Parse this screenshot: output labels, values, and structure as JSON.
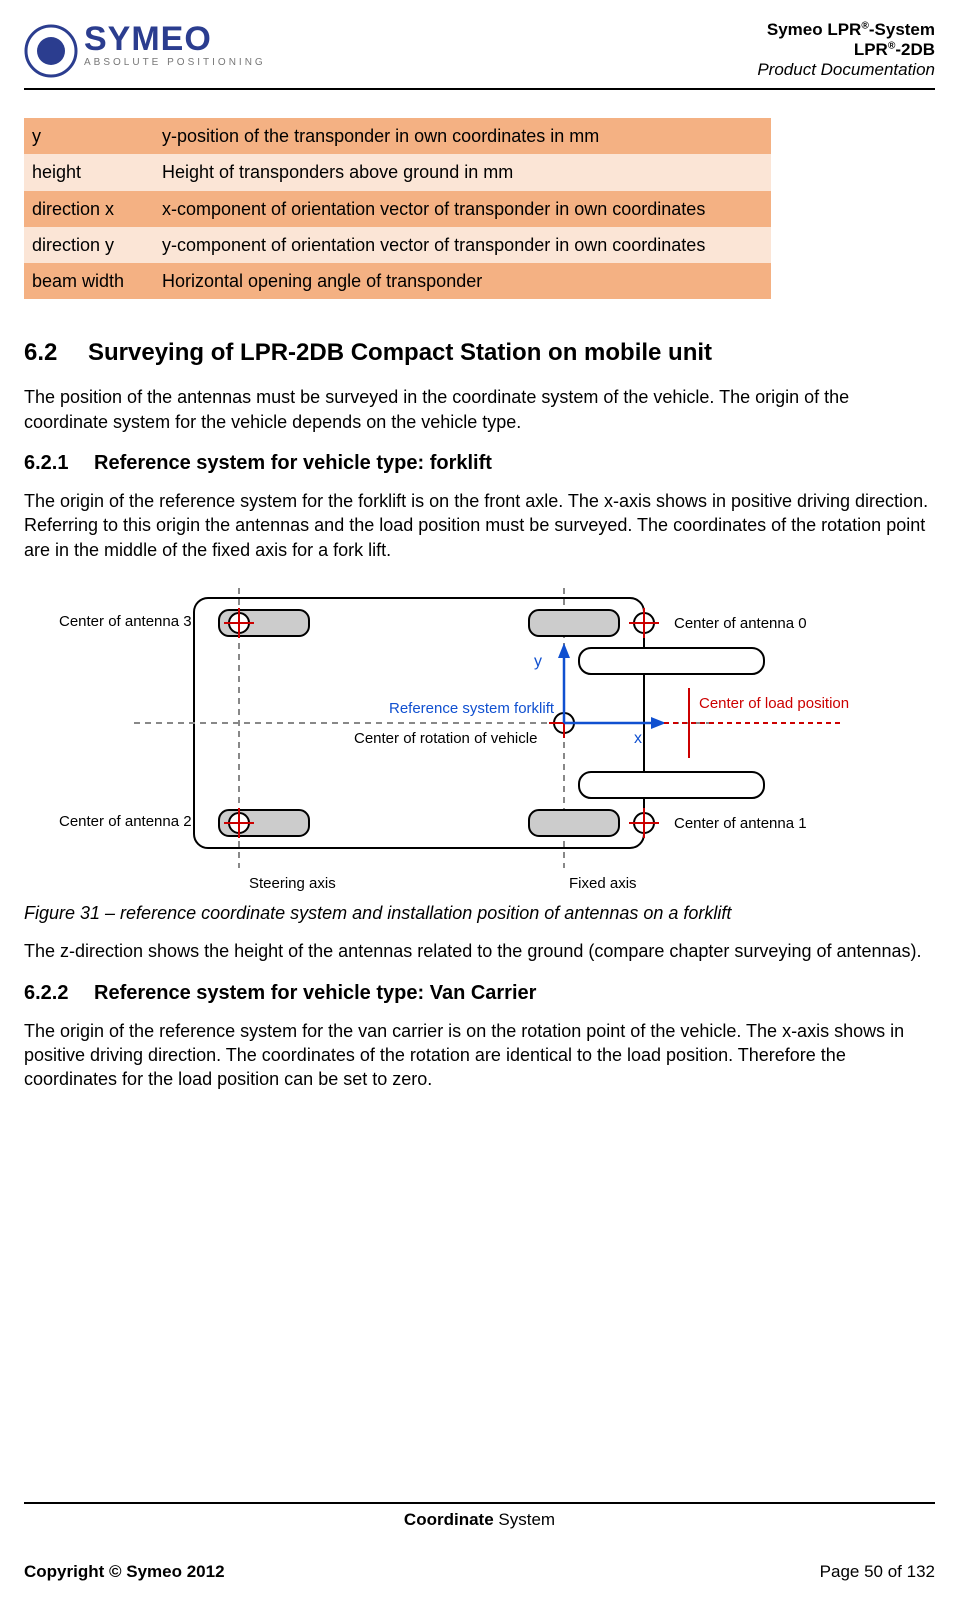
{
  "header": {
    "brand_name": "SYMEO",
    "brand_tagline": "ABSOLUTE POSITIONING",
    "line1_pre": "Symeo LPR",
    "line1_sup": "®",
    "line1_post": "-System",
    "line2_pre": "LPR",
    "line2_sup": "®",
    "line2_post": "-2DB",
    "line3": "Product Documentation"
  },
  "table": {
    "rows": [
      {
        "key": "y",
        "desc": "y-position of the transponder in own coordinates in mm",
        "cls": "row-dark"
      },
      {
        "key": "height",
        "desc": "Height of transponders above ground in mm",
        "cls": "row-light"
      },
      {
        "key": "direction x",
        "desc": "x-component of orientation vector of transponder in own coordinates",
        "cls": "row-dark"
      },
      {
        "key": "direction y",
        "desc": "y-component of orientation vector of transponder in own coordinates",
        "cls": "row-light"
      },
      {
        "key": "beam width",
        "desc": "Horizontal opening angle of transponder",
        "cls": "row-dark"
      }
    ]
  },
  "section": {
    "num": "6.2",
    "title": "Surveying of LPR-2DB Compact Station on mobile unit",
    "intro": "The position of the antennas must be surveyed in the coordinate system of the vehicle. The origin of the coordinate system for the vehicle depends on the vehicle type."
  },
  "sub1": {
    "num": "6.2.1",
    "title": "Reference system for vehicle type: forklift",
    "text": "The origin of the reference system for the forklift is on the front axle. The x-axis shows in positive driving direction. Referring to this origin the antennas and the load position must be surveyed. The coordinates of the rotation point are in the middle of the fixed axis for a fork lift."
  },
  "figure": {
    "ant3": "Center of antenna 3",
    "ant0": "Center of antenna 0",
    "ant2": "Center of antenna 2",
    "ant1": "Center of antenna 1",
    "ref_sys": "Reference system forklift",
    "rot_center": "Center of rotation of vehicle",
    "load_pos": "Center of load position",
    "steering": "Steering axis",
    "fixed": "Fixed axis",
    "y_lbl": "y",
    "x_lbl": "x",
    "caption": "Figure 31 – reference coordinate system and installation position of antennas on a forklift"
  },
  "after_fig": "The z-direction shows the height of the antennas related to the ground (compare chapter surveying of antennas).",
  "sub2": {
    "num": "6.2.2",
    "title": "Reference system for vehicle type: Van Carrier",
    "text": "The origin of the reference system for the van carrier is on the rotation point of the vehicle. The x-axis shows in positive driving direction. The coordinates of the rotation are identical to the load position. Therefore the coordinates for the load position can be set to zero."
  },
  "footer": {
    "section_bold": "Coordinate",
    "section_rest": " System",
    "copyright": "Copyright © Symeo 2012",
    "page": "Page 50 of 132"
  }
}
